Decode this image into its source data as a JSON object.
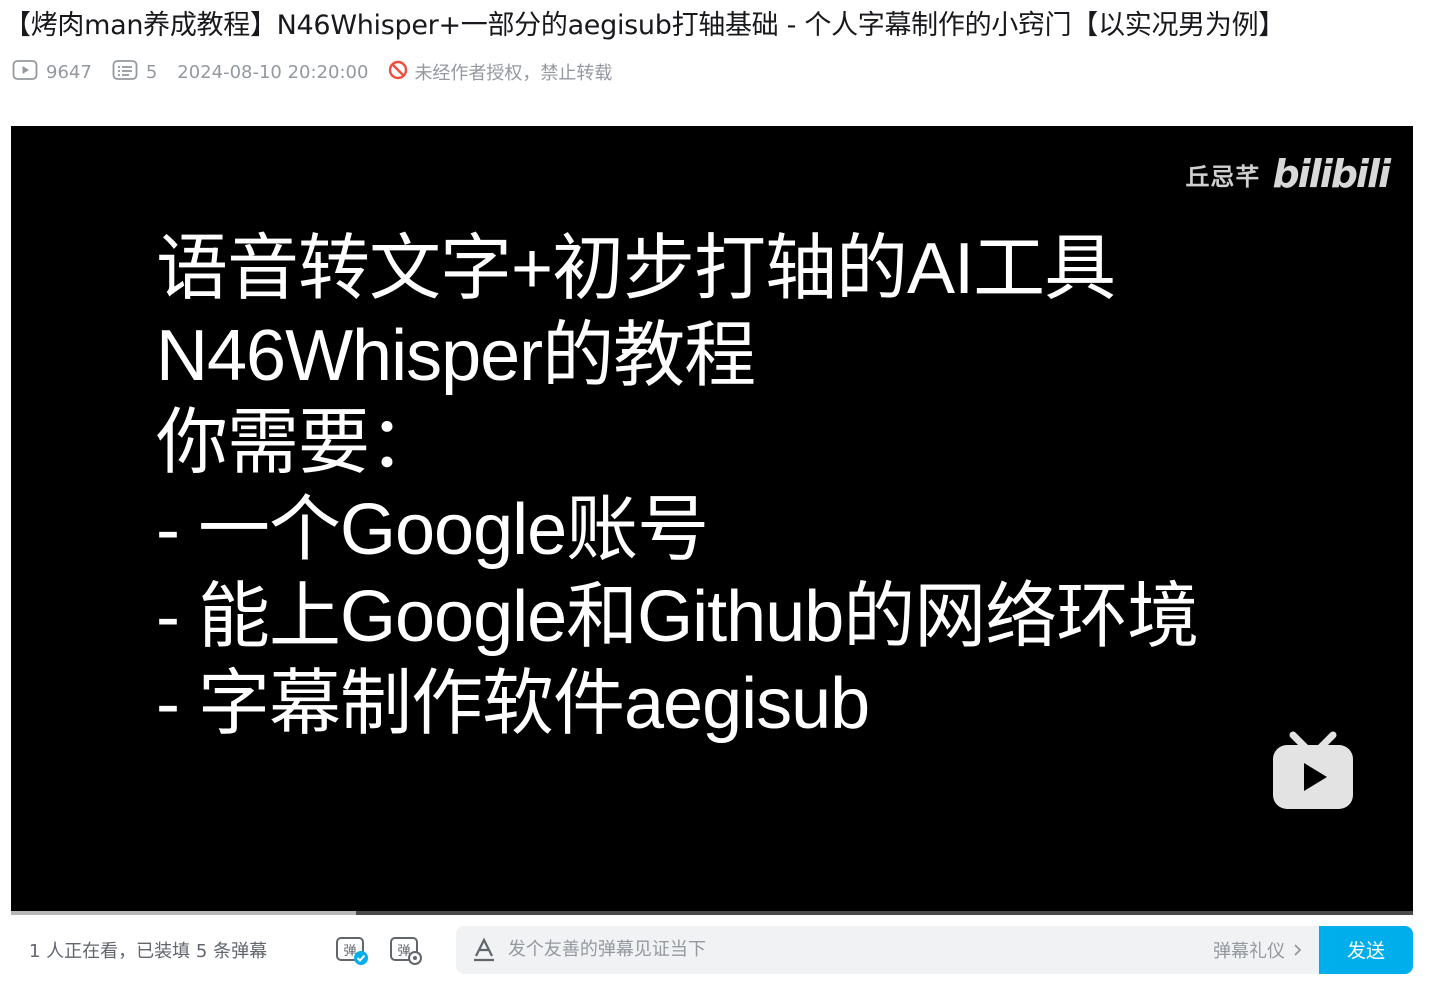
{
  "video": {
    "title": "【烤肉man养成教程】N46Whisper+一部分的aegisub打轴基础 - 个人字幕制作的小窍门【以实况男为例】",
    "views": "9647",
    "danmaku_count": "5",
    "publish_time": "2024-08-10 20:20:00",
    "copyright_notice": "未经作者授权，禁止转载"
  },
  "player": {
    "progress": 0.246,
    "watermark_uploader": "丘忌芊",
    "watermark_logo": "bilibili",
    "subtitle_lines": [
      "语音转文字+初步打轴的AI工具",
      "N46Whisper的教程",
      "你需要：",
      "- 一个Google账号",
      "- 能上Google和Github的网络环境",
      "- 字幕制作软件aegisub"
    ]
  },
  "danmaku_bar": {
    "viewer_status": "1 人正在看，已装填 5 条弹幕",
    "input_placeholder": "发个友善的弹幕见证当下",
    "etiquette_label": "弹幕礼仪",
    "send_label": "发送"
  },
  "colors": {
    "accent": "#00aeec",
    "text_secondary": "#9499a0",
    "forbidden": "#f04f3c"
  }
}
